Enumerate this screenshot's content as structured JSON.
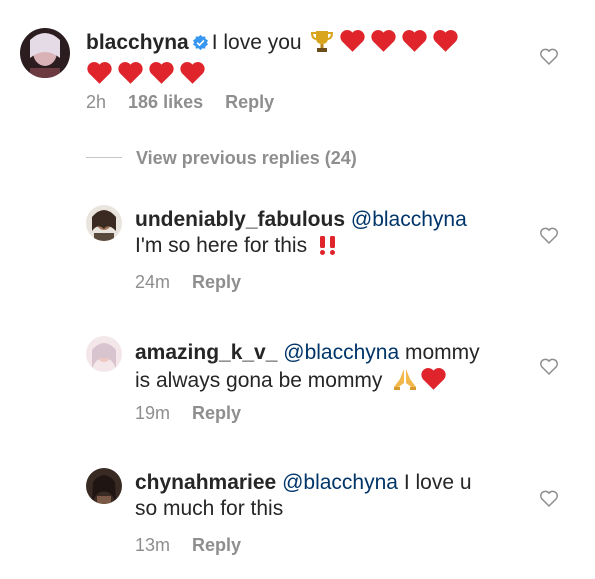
{
  "comments": [
    {
      "username": "blacchyna",
      "text_line1": "I love you",
      "time": "2h",
      "likes": "186 likes",
      "reply_label": "Reply"
    },
    {
      "username": "undeniably_fabulous",
      "mention": "@blacchyna",
      "text_line2": "I'm so here for this",
      "time": "24m",
      "reply_label": "Reply"
    },
    {
      "username": "amazing_k_v_",
      "mention": "@blacchyna",
      "text_line1_tail": "mommy",
      "text_line2": "is always gona be mommy",
      "time": "19m",
      "reply_label": "Reply"
    },
    {
      "username": "chynahmariee",
      "mention": "@blacchyna",
      "text_line1_tail": "I love u",
      "text_line2": "so much for this",
      "time": "13m",
      "reply_label": "Reply"
    }
  ],
  "view_previous": "View previous replies (24)",
  "colors": {
    "heart": "#e0242b",
    "mention": "#003569",
    "muted": "#8e8e8e",
    "verified": "#3897f0"
  },
  "icons": [
    "heart-outline-icon",
    "verified-badge-icon",
    "trophy-emoji-icon",
    "red-heart-emoji-icon",
    "double-exclamation-emoji-icon",
    "praying-hands-emoji-icon"
  ]
}
